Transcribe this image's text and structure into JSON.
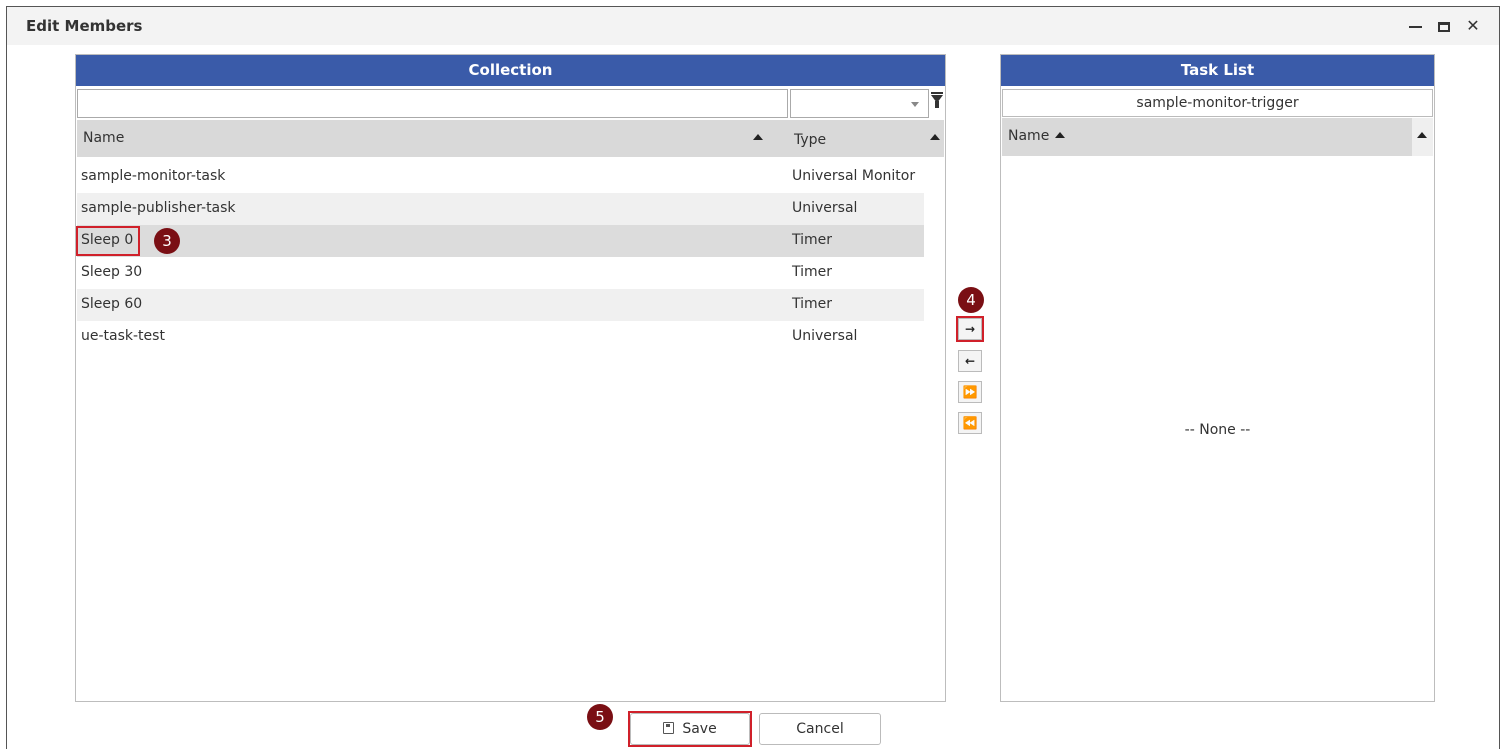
{
  "window": {
    "title": "Edit Members"
  },
  "collection": {
    "header": "Collection",
    "filter_value": "",
    "type_filter_value": "",
    "columns": {
      "name": "Name",
      "type": "Type"
    },
    "rows": [
      {
        "name": "sample-monitor-task",
        "type": "Universal Monitor"
      },
      {
        "name": "sample-publisher-task",
        "type": "Universal"
      },
      {
        "name": "Sleep 0",
        "type": "Timer"
      },
      {
        "name": "Sleep 30",
        "type": "Timer"
      },
      {
        "name": "Sleep 60",
        "type": "Timer"
      },
      {
        "name": "ue-task-test",
        "type": "Universal"
      }
    ],
    "selected_row": "Sleep 0"
  },
  "move_buttons": {
    "add": "→",
    "remove": "←",
    "add_all": "⏩",
    "remove_all": "⏪"
  },
  "task_list": {
    "header": "Task List",
    "name": "sample-monitor-trigger",
    "columns": {
      "name": "Name"
    },
    "empty_text": "-- None --"
  },
  "footer": {
    "save_label": "Save",
    "cancel_label": "Cancel"
  },
  "callouts": {
    "step3": "3",
    "step4": "4",
    "step5": "5"
  },
  "colors": {
    "header_blue": "#3a5ba9",
    "callout": "#7a0f14",
    "highlight": "#d0202a"
  }
}
